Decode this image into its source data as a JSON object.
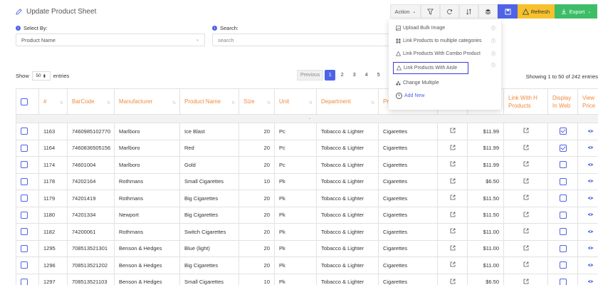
{
  "header": {
    "title": "Update Product Sheet"
  },
  "toolbar": {
    "action_label": "Action",
    "refresh_label": "Refresh",
    "export_label": "Export"
  },
  "filters": {
    "select_by_label": "Select By:",
    "select_by_value": "Product Name",
    "search_label": "Search:",
    "search_placeholder": "search"
  },
  "listing": {
    "show_label": "Show",
    "show_value": "50",
    "entries_label": "entries",
    "showing_text": "Showing 1 to 50 of 242 entries"
  },
  "pagination": {
    "previous": "Previous",
    "pages": [
      "1",
      "2",
      "3",
      "4",
      "5"
    ],
    "active": "1"
  },
  "dropdown": {
    "items": [
      "Upload Bulk Image",
      "Link Products to multiple categories",
      "Link Products With Combo Product",
      "Link Products With Aisle",
      "Change Multiple",
      "Add New"
    ]
  },
  "table": {
    "headers": [
      "#",
      "BarCode",
      "Manufacturer",
      "Product Name",
      "Size",
      "Unit",
      "Department",
      "Pri Ca",
      "",
      "",
      "Link With H Products",
      "Display In Web",
      "View Price"
    ],
    "divider": "-",
    "rows": [
      {
        "id": "1163",
        "barcode": "7460985102770",
        "manufacturer": "Marlboro",
        "product": "Ice Blast",
        "size": "20",
        "unit": "Pc",
        "department": "Tobacco & Lighter",
        "category": "Cigarettes",
        "price": "$11.99",
        "web": true
      },
      {
        "id": "1164",
        "barcode": "7460836505156",
        "manufacturer": "Marlboro",
        "product": "Red",
        "size": "20",
        "unit": "Pc",
        "department": "Tobacco & Lighter",
        "category": "Cigarettes",
        "price": "$11.99",
        "web": true
      },
      {
        "id": "1174",
        "barcode": "74601004",
        "manufacturer": "Marlboro",
        "product": "Gold",
        "size": "20",
        "unit": "Pc",
        "department": "Tobacco & Lighter",
        "category": "Cigarettes",
        "price": "$11.99",
        "web": false
      },
      {
        "id": "1178",
        "barcode": "74202164",
        "manufacturer": "Rothmans",
        "product": "Small Cigarettes",
        "size": "10",
        "unit": "Pk",
        "department": "Tobacco & Lighter",
        "category": "Cigarettes",
        "price": "$6.50",
        "web": false
      },
      {
        "id": "1179",
        "barcode": "74201419",
        "manufacturer": "Rothmans",
        "product": "Big Cigarettes",
        "size": "20",
        "unit": "Pk",
        "department": "Tobacco & Lighter",
        "category": "Cigarettes",
        "price": "$11.50",
        "web": false
      },
      {
        "id": "1180",
        "barcode": "74201334",
        "manufacturer": "Newport",
        "product": "Big Cigarettes",
        "size": "20",
        "unit": "Pk",
        "department": "Tobacco & Lighter",
        "category": "Cigarettes",
        "price": "$11.50",
        "web": false
      },
      {
        "id": "1182",
        "barcode": "74200061",
        "manufacturer": "Rothmans",
        "product": "Switch Cigarettes",
        "size": "20",
        "unit": "Pk",
        "department": "Tobacco & Lighter",
        "category": "Cigarettes",
        "price": "$11.00",
        "web": false
      },
      {
        "id": "1295",
        "barcode": "708513521301",
        "manufacturer": "Benson & Hedges",
        "product": "Blue (light)",
        "size": "20",
        "unit": "Pk",
        "department": "Tobacco & Lighter",
        "category": "Cigarettes",
        "price": "$11.00",
        "web": false
      },
      {
        "id": "1296",
        "barcode": "708513521202",
        "manufacturer": "Benson & Hedges",
        "product": "Big Cigarettes",
        "size": "20",
        "unit": "Pk",
        "department": "Tobacco & Lighter",
        "category": "Cigarettes",
        "price": "$11.00",
        "web": false
      },
      {
        "id": "1297",
        "barcode": "708513521103",
        "manufacturer": "Benson & Hedges",
        "product": "Small Cigarettes",
        "size": "10",
        "unit": "Pk",
        "department": "Tobacco & Lighter",
        "category": "Cigarettes",
        "price": "$6.50",
        "web": false
      }
    ]
  },
  "colors": {
    "accent": "#4f63e6",
    "header_text": "#f08a3e",
    "refresh": "#f7c12d",
    "export": "#3dbd67"
  }
}
